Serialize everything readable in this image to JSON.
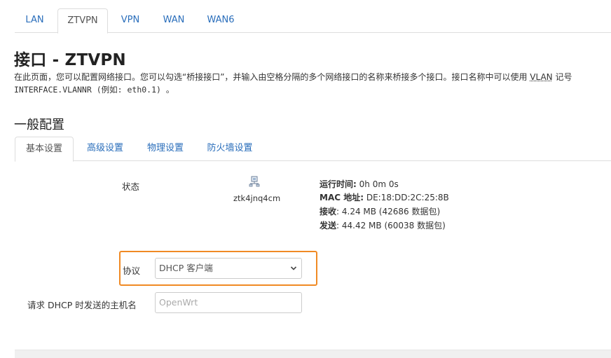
{
  "top_tabs": [
    {
      "label": "LAN"
    },
    {
      "label": "ZTVPN"
    },
    {
      "label": "VPN"
    },
    {
      "label": "WAN"
    },
    {
      "label": "WAN6"
    }
  ],
  "page": {
    "title": "接口 - ZTVPN",
    "description_prefix": "在此页面，您可以配置网络接口。您可以勾选“桥接接口”，并输入由空格分隔的多个网络接口的名称来桥接多个接口。接口名称中可以使用",
    "description_abbr": "VLAN",
    "description_suffix": "记号",
    "description_code": "INTERFACE.VLANNR (例如: eth0.1) 。"
  },
  "section": {
    "title": "一般配置"
  },
  "sub_tabs": [
    {
      "label": "基本设置"
    },
    {
      "label": "高级设置"
    },
    {
      "label": "物理设置"
    },
    {
      "label": "防火墙设置"
    }
  ],
  "status": {
    "label": "状态",
    "device_name": "ztk4jnq4cm",
    "uptime_label": "运行时间:",
    "uptime_value": "0h 0m 0s",
    "mac_label": "MAC 地址:",
    "mac_value": "DE:18:DD:2C:25:8B",
    "rx_label": "接收",
    "rx_value": ": 4.24 MB (42686 数据包)",
    "tx_label": "发送",
    "tx_value": ": 44.42 MB (60038 数据包)"
  },
  "protocol": {
    "label": "协议",
    "selected": "DHCP 客户端"
  },
  "hostname": {
    "label": "请求 DHCP 时发送的主机名",
    "placeholder": "OpenWrt"
  },
  "colors": {
    "link": "#2a6ebb",
    "highlight": "#f08a24"
  }
}
